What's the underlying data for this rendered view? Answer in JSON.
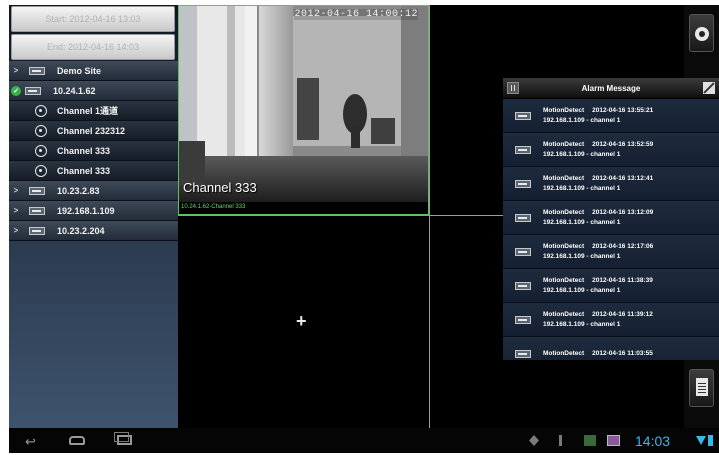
{
  "search": {
    "start": "Start: 2012-04-16 13:03",
    "end": "End: 2012-04-16 14:03"
  },
  "tree": [
    {
      "type": "site",
      "arrow": ">",
      "label": "Demo Site"
    },
    {
      "type": "site",
      "arrow": "v",
      "label": "10.24.1.62"
    },
    {
      "type": "channel",
      "label": "Channel 1通道"
    },
    {
      "type": "channel",
      "label": "Channel 232312"
    },
    {
      "type": "channel",
      "label": "Channel 333"
    },
    {
      "type": "channel",
      "label": "Channel 333"
    },
    {
      "type": "site",
      "arrow": ">",
      "label": "10.23.2.83"
    },
    {
      "type": "site",
      "arrow": ">",
      "label": "192.168.1.109"
    },
    {
      "type": "site",
      "arrow": ">",
      "label": "10.23.2.204"
    }
  ],
  "video": {
    "timestamp": "2012-04-16 14:00:12",
    "channel_name": "Channel 333",
    "source_label": "10.24.1.62-Channel 333",
    "empty_add": "+"
  },
  "alarm": {
    "title": "Alarm Message",
    "items": [
      {
        "event": "MotionDetect",
        "time": "2012-04-16 13:55:21",
        "source": "192.168.1.109 - channel 1"
      },
      {
        "event": "MotionDetect",
        "time": "2012-04-16 13:52:59",
        "source": "192.168.1.109 - channel 1"
      },
      {
        "event": "MotionDetect",
        "time": "2012-04-16 13:12:41",
        "source": "192.168.1.109 - channel 1"
      },
      {
        "event": "MotionDetect",
        "time": "2012-04-16 13:12:09",
        "source": "192.168.1.109 - channel 1"
      },
      {
        "event": "MotionDetect",
        "time": "2012-04-16 12:17:06",
        "source": "192.168.1.109 - channel 1"
      },
      {
        "event": "MotionDetect",
        "time": "2012-04-16 11:38:39",
        "source": "192.168.1.109 - channel 1"
      },
      {
        "event": "MotionDetect",
        "time": "2012-04-16 11:39:12",
        "source": "192.168.1.109 - channel 1"
      },
      {
        "event": "MotionDetect",
        "time": "2012-04-16 11:03:55",
        "source": ""
      }
    ]
  },
  "statusbar": {
    "time": "14:03"
  },
  "icons": {
    "back": "back-icon",
    "home": "home-icon",
    "recent": "recent-apps-icon",
    "settings": "settings-gear-icon",
    "document": "document-icon"
  },
  "colors": {
    "accent": "#39b7e7",
    "selected_border": "#5fbf5f",
    "expand_green": "#37b34a"
  }
}
